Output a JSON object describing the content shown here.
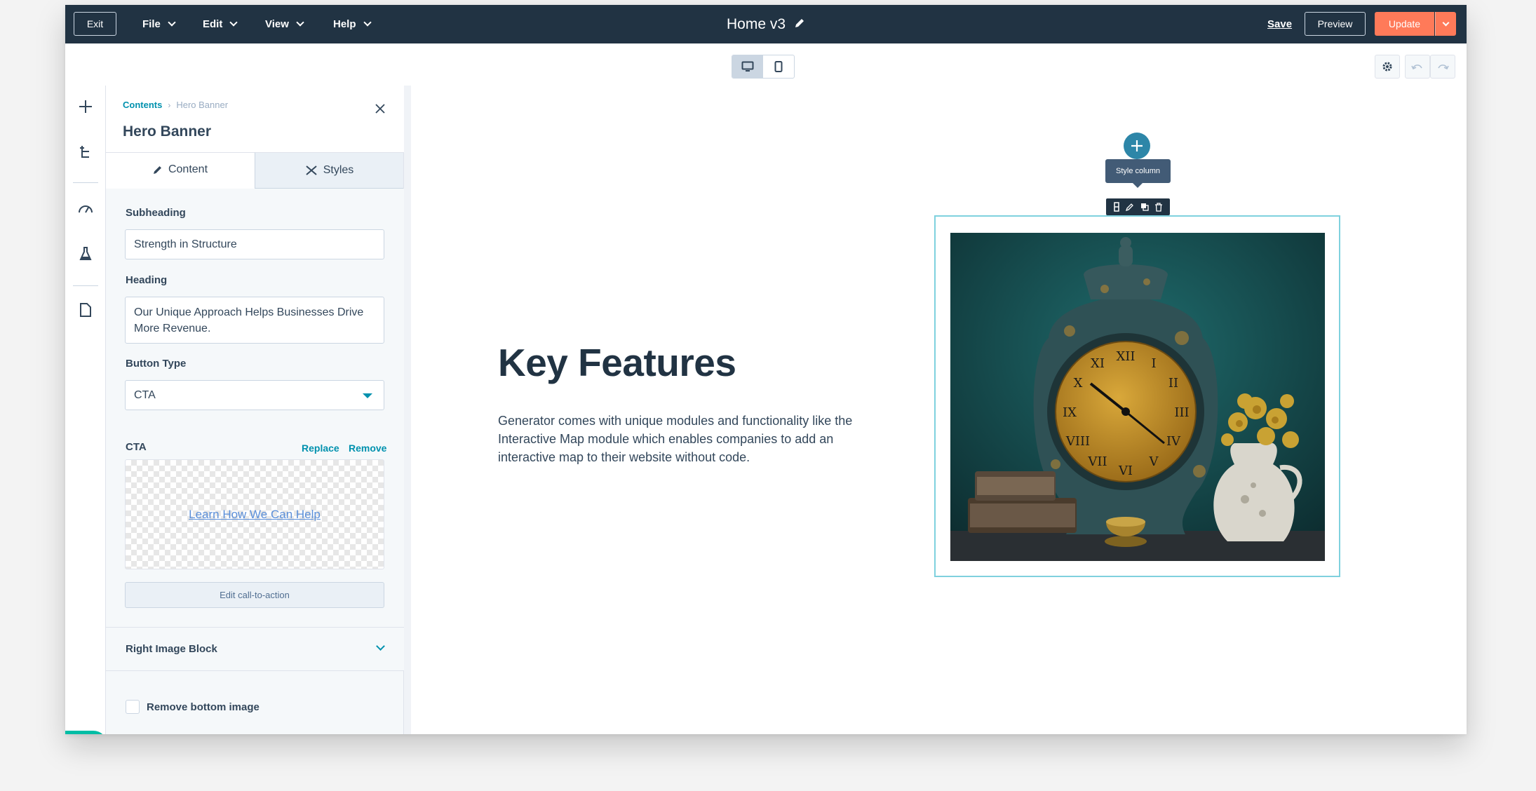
{
  "topbar": {
    "exit_label": "Exit",
    "menus": [
      "File",
      "Edit",
      "View",
      "Help"
    ],
    "doc_title": "Home v3",
    "save_label": "Save",
    "preview_label": "Preview",
    "update_label": "Update"
  },
  "sidebar": {
    "breadcrumb": {
      "root": "Contents",
      "separator": "›",
      "current": "Hero Banner"
    },
    "title": "Hero Banner",
    "tabs": [
      {
        "label": "Content"
      },
      {
        "label": "Styles"
      }
    ],
    "fields": {
      "subheading": {
        "label": "Subheading",
        "value": "Strength in Structure"
      },
      "heading": {
        "label": "Heading",
        "value": "Our Unique Approach Helps Businesses Drive More Revenue."
      },
      "button_type": {
        "label": "Button Type",
        "value": "CTA"
      },
      "cta": {
        "label": "CTA",
        "replace_label": "Replace",
        "remove_label": "Remove",
        "preview_link": "Learn How We Can Help",
        "edit_label": "Edit call-to-action"
      }
    },
    "right_image_block_label": "Right Image Block",
    "remove_bottom_image_label": "Remove bottom image"
  },
  "canvas": {
    "heading": "Key Features",
    "body": "Generator comes with unique modules and functionality like the Interactive Map module which enables companies to add an interactive map to their website without code.",
    "tooltip": "Style column"
  },
  "colors": {
    "topbar_bg": "#213343",
    "accent_orange": "#ff7a59",
    "link_teal": "#0091ae",
    "column_outline": "#7fd1de"
  }
}
